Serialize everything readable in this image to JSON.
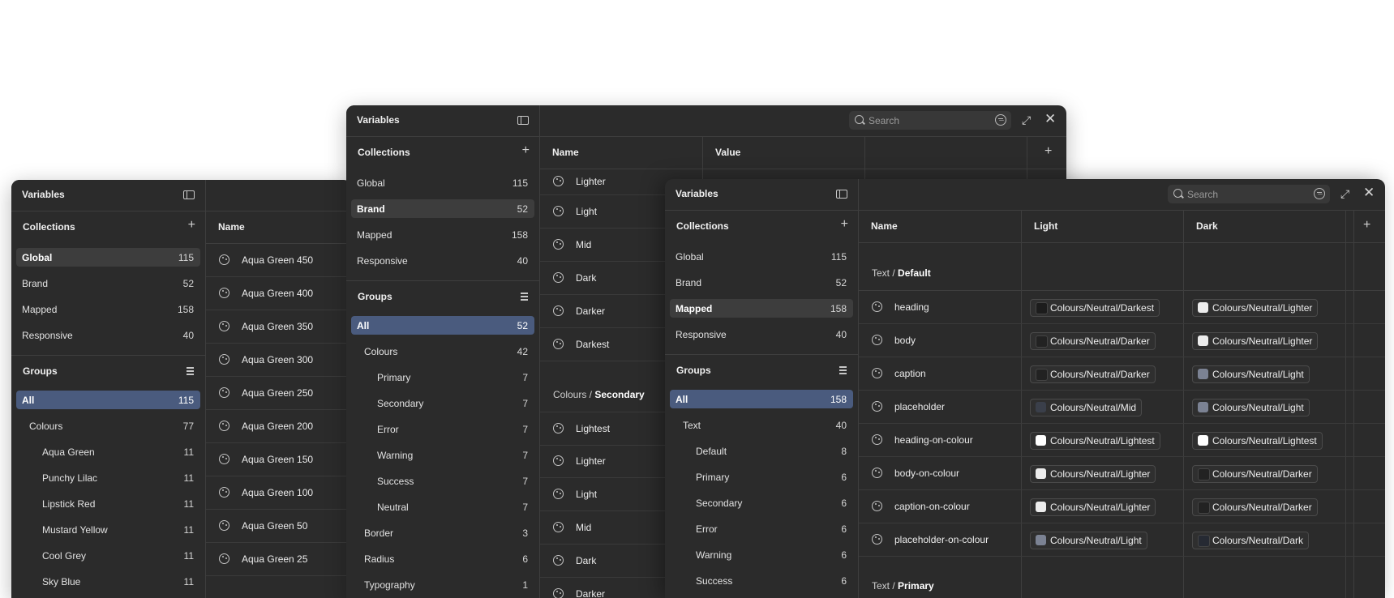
{
  "icons": {
    "panel": "sidebar-toggle-icon",
    "add": "plus-icon",
    "groups": "collapse-groups-icon",
    "variable": "palette-icon",
    "search": "search-icon",
    "filter": "filter-icon",
    "expand": "expand-icon",
    "close": "close-icon"
  },
  "glyphs": {
    "plus": "+",
    "expand": "⤢",
    "close": "✕"
  },
  "colors": {
    "accent": "#4a5b7e",
    "panel": "#2b2b2b"
  },
  "common": {
    "title": "Variables",
    "collections_label": "Collections",
    "groups_label": "Groups",
    "name_col": "Name",
    "value_col": "Value",
    "light_col": "Light",
    "dark_col": "Dark",
    "search_placeholder": "Search"
  },
  "collections": [
    {
      "name": "Global",
      "count": "115"
    },
    {
      "name": "Brand",
      "count": "52"
    },
    {
      "name": "Mapped",
      "count": "158"
    },
    {
      "name": "Responsive",
      "count": "40"
    }
  ],
  "win_a": {
    "selected_collection": "Global",
    "groups": [
      {
        "name": "All",
        "count": "115",
        "level": 0
      },
      {
        "name": "Colours",
        "count": "77",
        "level": 1
      },
      {
        "name": "Aqua Green",
        "count": "11",
        "level": 2
      },
      {
        "name": "Punchy Lilac",
        "count": "11",
        "level": 2
      },
      {
        "name": "Lipstick Red",
        "count": "11",
        "level": 2
      },
      {
        "name": "Mustard Yellow",
        "count": "11",
        "level": 2
      },
      {
        "name": "Cool Grey",
        "count": "11",
        "level": 2
      },
      {
        "name": "Sky Blue",
        "count": "11",
        "level": 2
      }
    ],
    "rows": [
      "Aqua Green 450",
      "Aqua Green 400",
      "Aqua Green 350",
      "Aqua Green 300",
      "Aqua Green 250",
      "Aqua Green 200",
      "Aqua Green 150",
      "Aqua Green 100",
      "Aqua Green 50",
      "Aqua Green 25"
    ]
  },
  "win_b": {
    "selected_collection": "Brand",
    "groups": [
      {
        "name": "All",
        "count": "52",
        "level": 0
      },
      {
        "name": "Colours",
        "count": "42",
        "level": 1
      },
      {
        "name": "Primary",
        "count": "7",
        "level": 2
      },
      {
        "name": "Secondary",
        "count": "7",
        "level": 2
      },
      {
        "name": "Error",
        "count": "7",
        "level": 2
      },
      {
        "name": "Warning",
        "count": "7",
        "level": 2
      },
      {
        "name": "Success",
        "count": "7",
        "level": 2
      },
      {
        "name": "Neutral",
        "count": "7",
        "level": 2
      },
      {
        "name": "Border",
        "count": "3",
        "level": 1
      },
      {
        "name": "Radius",
        "count": "6",
        "level": 1
      },
      {
        "name": "Typography",
        "count": "1",
        "level": 1
      }
    ],
    "rows_top": [
      "Lighter",
      "Light",
      "Mid",
      "Dark",
      "Darker",
      "Darkest"
    ],
    "group_prefix": "Colours /",
    "group_name": "Secondary",
    "rows_bottom": [
      "Lightest",
      "Lighter",
      "Light",
      "Mid",
      "Dark",
      "Darker"
    ]
  },
  "win_c": {
    "selected_collection": "Mapped",
    "groups": [
      {
        "name": "All",
        "count": "158",
        "level": 0
      },
      {
        "name": "Text",
        "count": "40",
        "level": 1
      },
      {
        "name": "Default",
        "count": "8",
        "level": 2
      },
      {
        "name": "Primary",
        "count": "6",
        "level": 2
      },
      {
        "name": "Secondary",
        "count": "6",
        "level": 2
      },
      {
        "name": "Error",
        "count": "6",
        "level": 2
      },
      {
        "name": "Warning",
        "count": "6",
        "level": 2
      },
      {
        "name": "Success",
        "count": "6",
        "level": 2
      }
    ],
    "group1_prefix": "Text /",
    "group1_name": "Default",
    "group2_prefix": "Text /",
    "group2_name": "Primary",
    "rows": [
      {
        "name": "heading",
        "light": "Colours/Neutral/Darkest",
        "light_sw": "#1c1c1c",
        "dark": "Colours/Neutral/Lighter",
        "dark_sw": "#ececec"
      },
      {
        "name": "body",
        "light": "Colours/Neutral/Darker",
        "light_sw": "#222222",
        "dark": "Colours/Neutral/Lighter",
        "dark_sw": "#ececec"
      },
      {
        "name": "caption",
        "light": "Colours/Neutral/Darker",
        "light_sw": "#222222",
        "dark": "Colours/Neutral/Light",
        "dark_sw": "#7b8293"
      },
      {
        "name": "placeholder",
        "light": "Colours/Neutral/Mid",
        "light_sw": "#3a3f4a",
        "dark": "Colours/Neutral/Light",
        "dark_sw": "#7b8293"
      },
      {
        "name": "heading-on-colour",
        "light": "Colours/Neutral/Lightest",
        "light_sw": "#ffffff",
        "dark": "Colours/Neutral/Lightest",
        "dark_sw": "#ffffff"
      },
      {
        "name": "body-on-colour",
        "light": "Colours/Neutral/Lighter",
        "light_sw": "#ececec",
        "dark": "Colours/Neutral/Darker",
        "dark_sw": "#222222"
      },
      {
        "name": "caption-on-colour",
        "light": "Colours/Neutral/Lighter",
        "light_sw": "#ececec",
        "dark": "Colours/Neutral/Darker",
        "dark_sw": "#222222"
      },
      {
        "name": "placeholder-on-colour",
        "light": "Colours/Neutral/Light",
        "light_sw": "#7b8293",
        "dark": "Colours/Neutral/Dark",
        "dark_sw": "#262a33"
      }
    ]
  }
}
